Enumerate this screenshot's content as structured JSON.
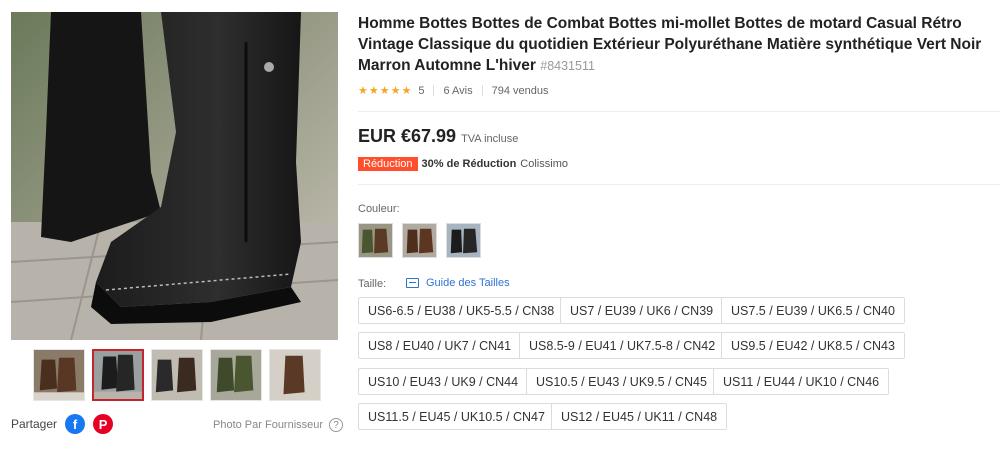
{
  "product": {
    "title": "Homme Bottes Bottes de Combat Bottes mi-mollet Bottes de motard Casual Rétro Vintage Classique du quotidien Extérieur Polyuréthane Matière synthétique Vert Noir Marron Automne L'hiver",
    "sku": "#8431511",
    "rating_value": "5",
    "reviews": "6 Avis",
    "sold": "794 vendus"
  },
  "price": {
    "amount": "EUR €67.99",
    "tax_note": "TVA incluse",
    "badge": "Réduction",
    "discount": "30% de Réduction",
    "shipping": "Colissimo"
  },
  "color": {
    "label": "Couleur:",
    "options": [
      "green-brown",
      "brown",
      "black"
    ]
  },
  "size": {
    "label": "Taille:",
    "guide": "Guide des Tailles",
    "options": [
      "US6-6.5 / EU38 / UK5-5.5 / CN38",
      "US7 / EU39 / UK6 / CN39",
      "US7.5 / EU39 / UK6.5 / CN40",
      "US8 / EU40 / UK7 / CN41",
      "US8.5-9 / EU41 / UK7.5-8 / CN42",
      "US9.5 / EU42 / UK8.5 / CN43",
      "US10 / EU43 / UK9 / CN44",
      "US10.5 / EU43 / UK9.5 / CN45",
      "US11 / EU44 / UK10 / CN46",
      "US11.5 / EU45 / UK10.5 / CN47",
      "US12 / EU45 / UK11 / CN48"
    ]
  },
  "share": {
    "label": "Partager",
    "facebook_glyph": "f",
    "pinterest_glyph": "P",
    "photo_credit": "Photo Par Fournisseur",
    "help_glyph": "?"
  },
  "colors": {
    "accent": "#c0262b",
    "badge": "#ff4f2d",
    "link": "#2f73d0",
    "star": "#f5a623"
  }
}
